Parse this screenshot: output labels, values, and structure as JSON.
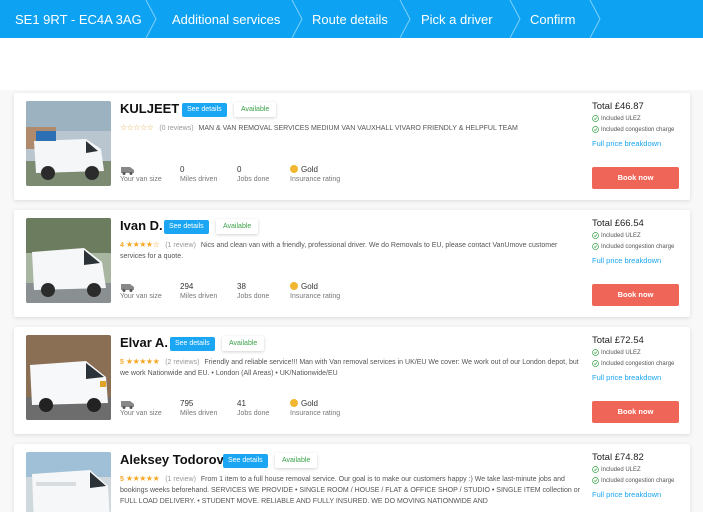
{
  "steps": {
    "postcode": "SE1 9RT - EC4A 3AG",
    "additional": "Additional services",
    "route": "Route details",
    "pick": "Pick a driver",
    "confirm": "Confirm"
  },
  "colors": {
    "primary": "#0da2f2",
    "book": "#ef6557",
    "available": "#3aa24a",
    "star": "#f5a623",
    "gold": "#f2b731"
  },
  "common": {
    "see_details": "See details",
    "available": "Available",
    "your_van_size": "Your van size",
    "miles_driven": "Miles driven",
    "jobs_done": "Jobs done",
    "insurance_rating": "Insurance rating",
    "included_ulez": "Included ULEZ",
    "included_congestion": "Included congestion charge",
    "full_price_breakdown": "Full price breakdown",
    "book_now": "Book now"
  },
  "drivers": [
    {
      "name": "KULJEET",
      "rating": "",
      "reviews": "(0 reviews)",
      "description": "MAN & VAN REMOVAL SERVICES MEDIUM VAN VAUXHALL VIVARO FRIENDLY & HELPFUL TEAM",
      "miles": "0",
      "jobs": "0",
      "insurance": "Gold",
      "total": "Total £46.87"
    },
    {
      "name": "Ivan D.",
      "rating": "4",
      "reviews": "(1 review)",
      "description": "Nics and clean van with a friendly, professional driver. We do Removals to EU, please contact VanUmove customer services for a quote.",
      "miles": "294",
      "jobs": "38",
      "insurance": "Gold",
      "total": "Total £66.54"
    },
    {
      "name": "Elvar A.",
      "rating": "5",
      "reviews": "(2 reviews)",
      "description": "Friendly and reliable service!!! Man with Van removal services in UK/EU We cover: We work out of our London depot, but we work Nationwide and EU. • London (All Areas) • UK/Nationwide/EU",
      "miles": "795",
      "jobs": "41",
      "insurance": "Gold",
      "total": "Total £72.54"
    },
    {
      "name": "Aleksey Todorov",
      "rating": "5",
      "reviews": "(1 review)",
      "description": "From 1 item to a full house removal service. Our goal is to make our customers happy :) We take last-minute jobs and bookings weeks beforehand. SERVICES WE PROVIDE • SINGLE ROOM / HOUSE / FLAT & OFFICE SHOP / STUDIO • SINGLE ITEM collection or FULL LOAD DELIVERY. • STUDENT MOVE. RELIABLE AND FULLY INSURED. WE DO MOVING NATIONWIDE AND",
      "miles": "",
      "jobs": "",
      "insurance": "",
      "total": "Total £74.82"
    }
  ]
}
